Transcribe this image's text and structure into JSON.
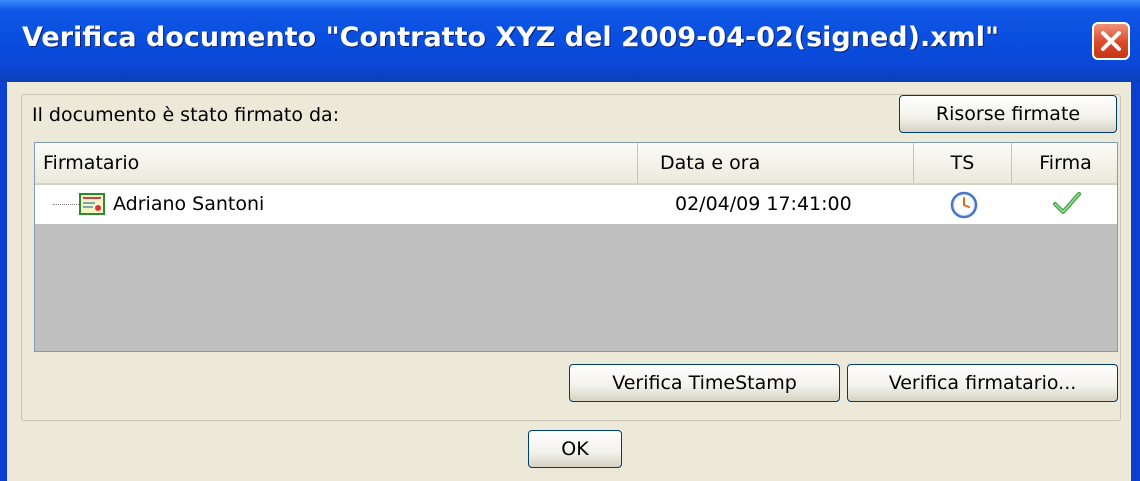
{
  "window": {
    "title": "Verifica documento \"Contratto XYZ del 2009-04-02(signed).xml\""
  },
  "signed_label": "Il documento è stato firmato da:",
  "buttons": {
    "signed_resources": "Risorse firmate",
    "verify_timestamp": "Verifica TimeStamp",
    "verify_signer": "Verifica firmatario...",
    "ok": "OK"
  },
  "table": {
    "columns": [
      "Firmatario",
      "Data e ora",
      "TS",
      "Firma"
    ],
    "rows": [
      {
        "signer": "Adriano Santoni",
        "datetime": "02/04/09 17:41:00",
        "ts_icon": "clock-icon",
        "signature_icon": "checkmark-icon"
      }
    ]
  },
  "colors": {
    "titlebar": "#0a4fe0",
    "close_button": "#d9482a",
    "checkmark": "#3ca33c",
    "clock": "#4a74c9"
  }
}
